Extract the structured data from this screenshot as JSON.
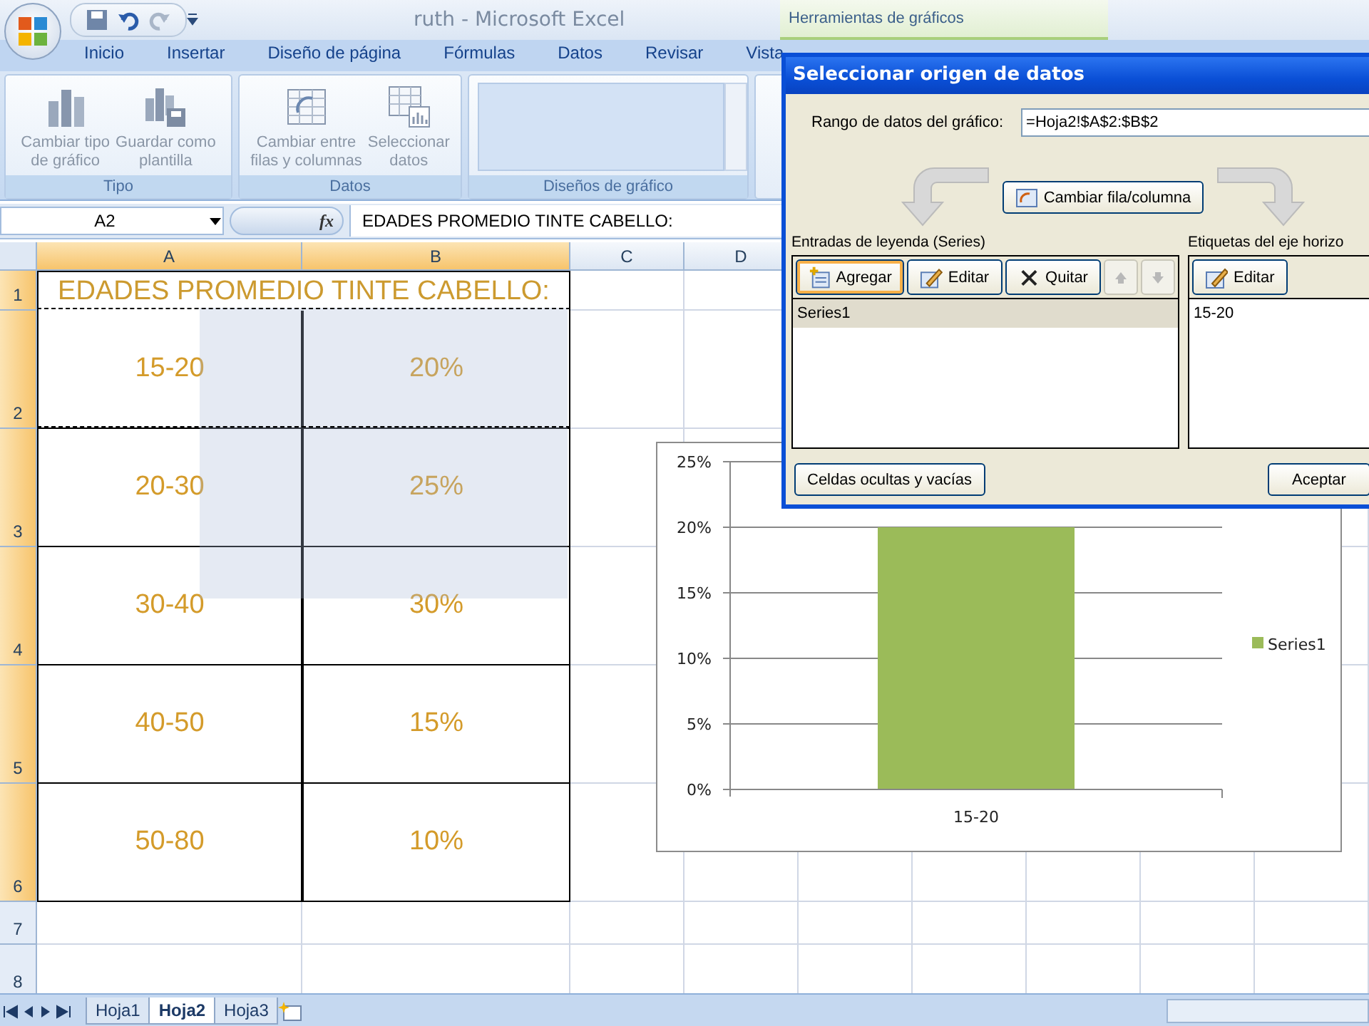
{
  "window": {
    "title": "ruth - Microsoft Excel",
    "contextual_title": "Herramientas de gráficos"
  },
  "ribbon_tabs": [
    {
      "label": "Inicio",
      "selected": false
    },
    {
      "label": "Insertar",
      "selected": false
    },
    {
      "label": "Diseño de página",
      "selected": false
    },
    {
      "label": "Fórmulas",
      "selected": false
    },
    {
      "label": "Datos",
      "selected": false
    },
    {
      "label": "Revisar",
      "selected": false
    },
    {
      "label": "Vista",
      "selected": false
    }
  ],
  "ribbon_groups": [
    {
      "label": "Tipo",
      "kind": "buttons",
      "buttons": [
        {
          "lines": [
            "Cambiar tipo",
            "de gráfico"
          ],
          "kind": "chart-type"
        },
        {
          "lines": [
            "Guardar como",
            "plantilla"
          ],
          "kind": "template"
        }
      ]
    },
    {
      "label": "Datos",
      "kind": "buttons",
      "buttons": [
        {
          "lines": [
            "Cambiar entre",
            "filas y columnas"
          ],
          "kind": "switch"
        },
        {
          "lines": [
            "Seleccionar",
            "datos"
          ],
          "kind": "select"
        }
      ]
    },
    {
      "label": "Diseños de gráfico",
      "kind": "gallery"
    }
  ],
  "formula_bar": {
    "name_box": "A2",
    "function_label": "fx",
    "content": "EDADES PROMEDIO TINTE CABELLO:"
  },
  "sheet": {
    "columns": [
      {
        "label": "A",
        "selected": true
      },
      {
        "label": "B",
        "selected": true
      },
      {
        "label": "C",
        "selected": false
      },
      {
        "label": "D",
        "selected": false
      }
    ],
    "rows": [
      {
        "label": "1",
        "selected": true
      },
      {
        "label": "2",
        "selected": true
      },
      {
        "label": "3",
        "selected": true
      },
      {
        "label": "4",
        "selected": true
      },
      {
        "label": "5",
        "selected": true
      },
      {
        "label": "6",
        "selected": true
      },
      {
        "label": "7",
        "selected": false
      },
      {
        "label": "8",
        "selected": false
      }
    ],
    "title": "EDADES PROMEDIO TINTE CABELLO:",
    "data": [
      [
        "15-20",
        "20%"
      ],
      [
        "20-30",
        "25%"
      ],
      [
        "30-40",
        "30%"
      ],
      [
        "40-50",
        "15%"
      ],
      [
        "50-80",
        "10%"
      ]
    ]
  },
  "chart": {
    "chart_data": {
      "type": "bar",
      "grid": true,
      "categories": [
        "15-20"
      ],
      "series": [
        {
          "name": "Series1",
          "color": "#9bbb59",
          "values": [
            0.2
          ]
        }
      ],
      "ylim": [
        0,
        0.25
      ],
      "yticks": [
        {
          "value": 0,
          "label": "0%"
        },
        {
          "value": 0.05,
          "label": "5%"
        },
        {
          "value": 0.1,
          "label": "10%"
        },
        {
          "value": 0.15,
          "label": "15%"
        },
        {
          "value": 0.2,
          "label": "20%"
        },
        {
          "value": 0.25,
          "label": "25%"
        }
      ]
    }
  },
  "dialog": {
    "title": "Seleccionar origen de datos",
    "range_label": "Rango de datos del gráfico:",
    "range_value": "=Hoja2!$A$2:$B$2",
    "switch_button": "Cambiar fila/columna",
    "series_panel": {
      "heading": "Entradas de leyenda (Series)",
      "buttons": [
        {
          "label": "Agregar",
          "kind": "add",
          "focused": true,
          "disabled": false
        },
        {
          "label": "Editar",
          "kind": "edit",
          "focused": false,
          "disabled": false
        },
        {
          "label": "Quitar",
          "kind": "remove",
          "focused": false,
          "disabled": false
        },
        {
          "kind": "up",
          "focused": false,
          "disabled": true
        },
        {
          "kind": "down",
          "focused": false,
          "disabled": true
        }
      ],
      "items": [
        {
          "label": "Series1",
          "selected": true
        }
      ]
    },
    "axis_panel": {
      "heading": "Etiquetas del eje horizo",
      "buttons": [
        {
          "label": "Editar",
          "kind": "edit",
          "focused": false,
          "disabled": false
        }
      ],
      "items": [
        {
          "label": "15-20",
          "selected": false
        }
      ]
    },
    "hidden_cells_button": "Celdas ocultas y vacías",
    "ok_button": "Aceptar"
  },
  "sheet_tabs": [
    {
      "label": "Hoja1",
      "selected": false
    },
    {
      "label": "Hoja2",
      "selected": true
    },
    {
      "label": "Hoja3",
      "selected": false
    }
  ]
}
